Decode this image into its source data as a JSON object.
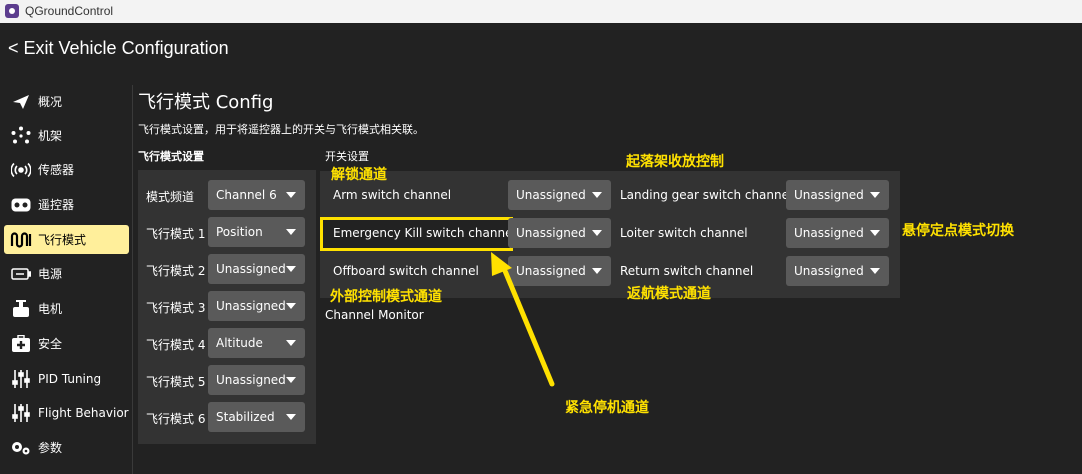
{
  "window": {
    "title": "QGroundControl"
  },
  "header": {
    "exit_label": "< Exit Vehicle Configuration"
  },
  "sidebar": {
    "items": [
      {
        "label": "概况",
        "icon": "paper-plane-icon"
      },
      {
        "label": "机架",
        "icon": "airframe-icon"
      },
      {
        "label": "传感器",
        "icon": "sensors-icon"
      },
      {
        "label": "遥控器",
        "icon": "radio-controller-icon"
      },
      {
        "label": "飞行模式",
        "icon": "flight-modes-icon",
        "active": true
      },
      {
        "label": "电源",
        "icon": "battery-icon"
      },
      {
        "label": "电机",
        "icon": "motor-icon"
      },
      {
        "label": "安全",
        "icon": "safety-icon"
      },
      {
        "label": "PID Tuning",
        "icon": "sliders-icon"
      },
      {
        "label": "Flight Behavior",
        "icon": "sliders-icon"
      },
      {
        "label": "参数",
        "icon": "gears-icon"
      }
    ]
  },
  "page": {
    "title": "飞行模式 Config",
    "description": "飞行模式设置，用于将遥控器上的开关与飞行模式相关联。"
  },
  "flight_mode_settings": {
    "title": "飞行模式设置",
    "rows": [
      {
        "label": "模式频道",
        "value": "Channel 6"
      },
      {
        "label": "飞行模式 1",
        "value": "Position"
      },
      {
        "label": "飞行模式 2",
        "value": "Unassigned"
      },
      {
        "label": "飞行模式 3",
        "value": "Unassigned"
      },
      {
        "label": "飞行模式 4",
        "value": "Altitude"
      },
      {
        "label": "飞行模式 5",
        "value": "Unassigned"
      },
      {
        "label": "飞行模式 6",
        "value": "Stabilized"
      }
    ]
  },
  "switch_settings": {
    "title": "开关设置",
    "left": [
      {
        "label": "Arm switch channel",
        "value": "Unassigned"
      },
      {
        "label": "Emergency Kill switch channel",
        "value": "Unassigned"
      },
      {
        "label": "Offboard switch channel",
        "value": "Unassigned"
      }
    ],
    "right": [
      {
        "label": "Landing gear switch channel",
        "value": "Unassigned"
      },
      {
        "label": "Loiter switch channel",
        "value": "Unassigned"
      },
      {
        "label": "Return switch channel",
        "value": "Unassigned"
      }
    ]
  },
  "channel_monitor": {
    "label": "Channel Monitor"
  },
  "annotations": {
    "arm": "解锁通道",
    "landing_gear": "起落架收放控制",
    "loiter": "悬停定点模式切换",
    "offboard": "外部控制模式通道",
    "return": "返航模式通道",
    "kill": "紧急停机通道"
  },
  "colors": {
    "background": "#222222",
    "panel": "#333333",
    "combo": "#5a5a5a",
    "active_item": "#ffef9b",
    "annotation": "#ffe100"
  }
}
